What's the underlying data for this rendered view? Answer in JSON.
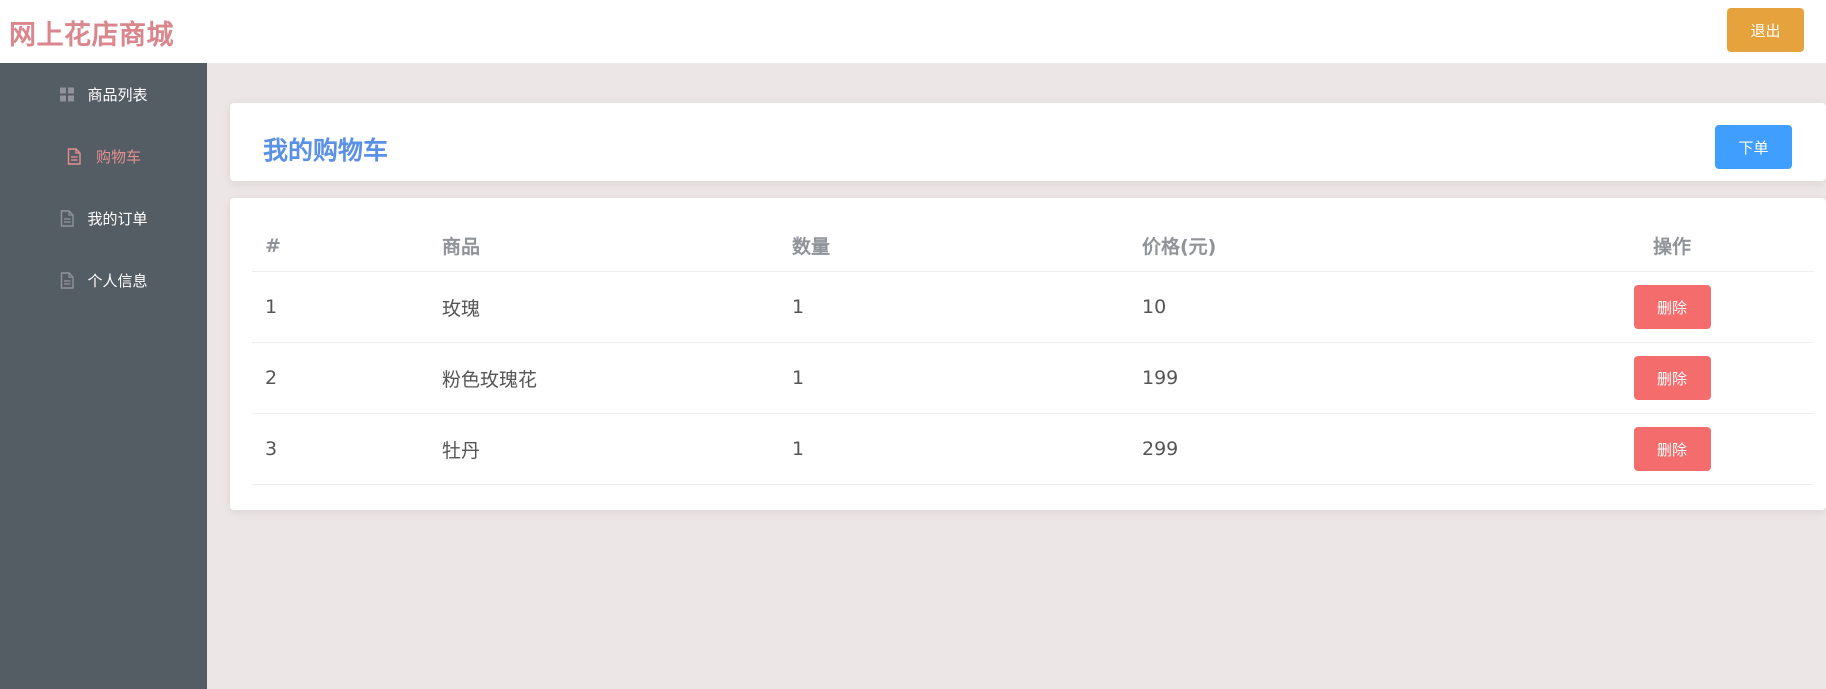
{
  "header": {
    "logo": "网上花店商城",
    "logout_label": "退出"
  },
  "sidebar": {
    "items": [
      {
        "label": "商品列表",
        "icon": "grid-icon",
        "active": false
      },
      {
        "label": "购物车",
        "icon": "document-icon",
        "active": true
      },
      {
        "label": "我的订单",
        "icon": "document-icon",
        "active": false
      },
      {
        "label": "个人信息",
        "icon": "document-icon",
        "active": false
      }
    ]
  },
  "main": {
    "title": "我的购物车",
    "order_label": "下单",
    "table": {
      "columns": [
        "#",
        "商品",
        "数量",
        "价格(元)",
        "操作"
      ],
      "rows": [
        {
          "index": "1",
          "product": "玫瑰",
          "quantity": "1",
          "price": "10",
          "action": "删除"
        },
        {
          "index": "2",
          "product": "粉色玫瑰花",
          "quantity": "1",
          "price": "199",
          "action": "删除"
        },
        {
          "index": "3",
          "product": "牡丹",
          "quantity": "1",
          "price": "299",
          "action": "删除"
        }
      ]
    }
  },
  "colors": {
    "logo": "#d9868c",
    "sidebar_bg": "#545c64",
    "active_nav": "#e59191",
    "title": "#5a90e6",
    "logout": "#e6a23c",
    "order": "#409eff",
    "delete": "#f56c6c"
  }
}
